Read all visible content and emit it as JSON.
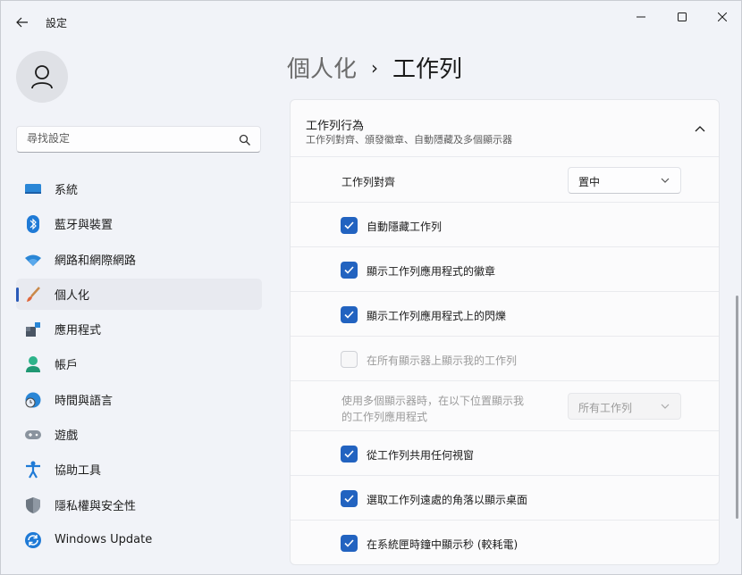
{
  "window": {
    "title": "設定"
  },
  "sidebar": {
    "search_placeholder": "尋找設定",
    "items": [
      {
        "label": "系統",
        "icon": "monitor-icon"
      },
      {
        "label": "藍牙與裝置",
        "icon": "bluetooth-icon"
      },
      {
        "label": "網路和網際網路",
        "icon": "wifi-icon"
      },
      {
        "label": "個人化",
        "icon": "brush-icon",
        "active": true
      },
      {
        "label": "應用程式",
        "icon": "apps-icon"
      },
      {
        "label": "帳戶",
        "icon": "account-icon"
      },
      {
        "label": "時間與語言",
        "icon": "globe-clock-icon"
      },
      {
        "label": "遊戲",
        "icon": "gamepad-icon"
      },
      {
        "label": "協助工具",
        "icon": "accessibility-icon"
      },
      {
        "label": "隱私權與安全性",
        "icon": "shield-icon"
      },
      {
        "label": "Windows Update",
        "icon": "update-icon"
      }
    ]
  },
  "breadcrumb": {
    "parent": "個人化",
    "separator": "›",
    "current": "工作列"
  },
  "section": {
    "title": "工作列行為",
    "subtitle": "工作列對齊、頒發徽章、自動隱藏及多個顯示器",
    "alignment": {
      "label": "工作列對齊",
      "value": "置中"
    },
    "auto_hide": {
      "label": "自動隱藏工作列",
      "checked": true
    },
    "show_badges": {
      "label": "顯示工作列應用程式的徽章",
      "checked": true
    },
    "show_flashing": {
      "label": "顯示工作列應用程式上的閃爍",
      "checked": true
    },
    "all_displays": {
      "label": "在所有顯示器上顯示我的工作列",
      "checked": false,
      "disabled": true
    },
    "multi_display": {
      "label_line1": "使用多個顯示器時，在以下位置顯示我",
      "label_line2": "的工作列應用程式",
      "value": "所有工作列",
      "disabled": true
    },
    "share_window": {
      "label": "從工作列共用任何視窗",
      "checked": true
    },
    "far_corner": {
      "label": "選取工作列遠處的角落以顯示桌面",
      "checked": true
    },
    "show_seconds": {
      "label": "在系統匣時鐘中顯示秒 (較耗電)",
      "checked": true
    }
  },
  "colors": {
    "accent": "#2263c0",
    "window_bg": "#f1f3f8",
    "card_bg": "#fbfbfc"
  }
}
